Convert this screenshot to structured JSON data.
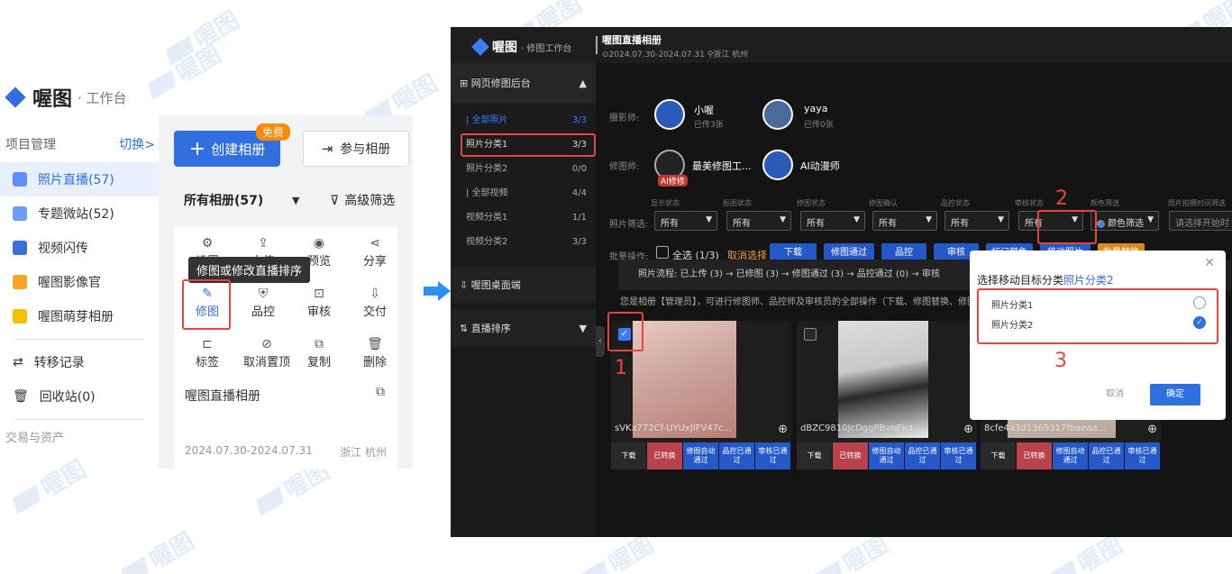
{
  "left": {
    "logo_name": "喔图",
    "logo_sub": "· 工作台",
    "sidebar": {
      "section_title": "项目管理",
      "switch": "切换>",
      "items": [
        {
          "label": "照片直播(57)",
          "color": "#5b8ff9",
          "active": true
        },
        {
          "label": "专题微站(52)",
          "color": "#6aa0f5"
        },
        {
          "label": "视频闪传",
          "color": "#3a6fd9"
        },
        {
          "label": "喔图影像官",
          "color": "#f5a623"
        },
        {
          "label": "喔图萌芽相册",
          "color": "#f5c000"
        }
      ],
      "items2": [
        {
          "label": "转移记录",
          "icon": "transfer-icon"
        },
        {
          "label": "回收站(0)",
          "icon": "trash-icon"
        }
      ],
      "footer": "交易与资产"
    },
    "create_btn": "创建相册",
    "free_badge": "免费",
    "join_btn": "参与相册",
    "all_albums": "所有相册(57)",
    "adv_filter": "高级筛选",
    "tooltip": "修图或修改直播排序",
    "grid": [
      {
        "label": "设置",
        "icon": "⚙"
      },
      {
        "label": "上传",
        "icon": "⇪"
      },
      {
        "label": "预览",
        "icon": "◉"
      },
      {
        "label": "分享",
        "icon": "⋖"
      },
      {
        "label": "修图",
        "icon": "✎",
        "active": true
      },
      {
        "label": "品控",
        "icon": "⛨"
      },
      {
        "label": "审核",
        "icon": "⊡"
      },
      {
        "label": "交付",
        "icon": "⇩"
      },
      {
        "label": "标签",
        "icon": "⊏"
      },
      {
        "label": "取消置顶",
        "icon": "⊘"
      },
      {
        "label": "复制",
        "icon": "⧉"
      },
      {
        "label": "删除",
        "icon": "🗑"
      }
    ],
    "card_name": "喔图直播相册",
    "card_date": "2024.07.30-2024.07.31",
    "card_loc": "浙江 杭州"
  },
  "right": {
    "logo_name": "喔图",
    "logo_sub": "· 修图工作台",
    "title": "喔图直播相册",
    "subtitle": "⊙2024.07.30-2024.07.31  ⚲浙江 杭州",
    "side": {
      "header": "网页修图后台",
      "rows": [
        {
          "label": "| 全部照片",
          "count": "3/3",
          "blue": true
        },
        {
          "label": "照片分类1",
          "count": "3/3"
        },
        {
          "label": "照片分类2",
          "count": "0/0"
        },
        {
          "label": "| 全部视频",
          "count": "4/4"
        },
        {
          "label": "视频分类1",
          "count": "1/1"
        },
        {
          "label": "视频分类2",
          "count": "3/3"
        }
      ],
      "desktop": "喔图桌面端",
      "live_sort": "直播排序"
    },
    "photographer_label": "摄影师:",
    "retoucher_label": "修图师:",
    "photographers": [
      {
        "name": "小喔",
        "sub": "已传3张"
      },
      {
        "name": "yaya",
        "sub": "已传0张"
      }
    ],
    "retouchers": [
      {
        "name": "最美修图工...",
        "badge": "AI修修"
      },
      {
        "name": "AI动漫师"
      }
    ],
    "filter_label": "照片筛选:",
    "filters": [
      {
        "title": "显示状态",
        "value": "所有"
      },
      {
        "title": "抠图状态",
        "value": "所有"
      },
      {
        "title": "修图状态",
        "value": "所有"
      },
      {
        "title": "修图确认",
        "value": "所有"
      },
      {
        "title": "品控状态",
        "value": "所有"
      },
      {
        "title": "审核状态",
        "value": "所有"
      },
      {
        "title": "颜色筛选",
        "value": "颜色筛选"
      },
      {
        "title": "照片拍摄时间筛选",
        "value": "请选择开始时"
      }
    ],
    "batch_label": "批量操作:",
    "select_all": "全选 (1/3)",
    "cancel_select": "取消选择",
    "batch_btns": [
      "下载",
      "修图通过",
      "品控",
      "审核",
      "标记颜色",
      "移动照片",
      "批量替换"
    ],
    "flow": "照片流程: 已上传 (3) → 已修图 (3) → 修图通过 (3) → 品控通过 (0) → 审核",
    "perm": "您是相册【管理员】，可进行修图师、品控师及审核员的全部操作（下载、修图替换、修图",
    "photos": [
      {
        "name": "sVKx772Cf-UYUxJIFV47c...",
        "checked": true
      },
      {
        "name": "dBZC9810JcDggPBvnEkd...",
        "checked": false
      },
      {
        "name": "8cfe4a3d1369317fbaeaa...",
        "checked": false
      }
    ],
    "photo_actions": [
      "下载",
      "已转换",
      "修图自动通过",
      "品控已通过",
      "审核已通过"
    ],
    "modal": {
      "title_prefix": "选择移动目标分类",
      "title_target": "照片分类2",
      "options": [
        "照片分类1",
        "照片分类2"
      ],
      "cancel": "取消",
      "ok": "确定"
    },
    "step_nums": [
      "1",
      "2",
      "3"
    ]
  },
  "watermark": "喔图"
}
